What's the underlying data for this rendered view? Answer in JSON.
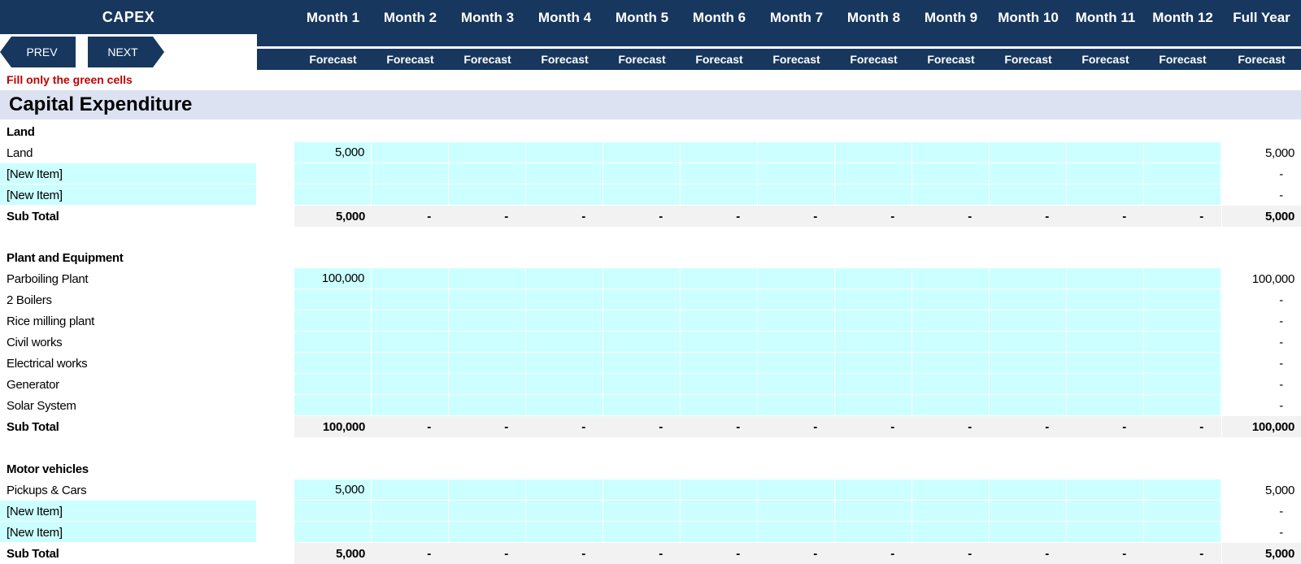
{
  "sheet": {
    "title": "CAPEX",
    "prev_label": "PREV",
    "next_label": "NEXT",
    "note": "Fill only the green cells",
    "section_title": "Capital Expenditure"
  },
  "columns": [
    "Month 1",
    "Month 2",
    "Month 3",
    "Month 4",
    "Month 5",
    "Month 6",
    "Month 7",
    "Month 8",
    "Month 9",
    "Month 10",
    "Month 11",
    "Month 12",
    "Full Year"
  ],
  "subheader": "Forecast",
  "colors": {
    "header_bg": "#17375e",
    "input_cell": "#ccffff",
    "section_bg": "#dce2f1",
    "subtotal_bg": "#f2f2f2",
    "note": "#c00000"
  },
  "groups": [
    {
      "title": "Land",
      "items": [
        {
          "label": "Land",
          "month1": "5,000",
          "full_year": "5,000",
          "editable_label": false
        },
        {
          "label": "[New Item]",
          "month1": "",
          "full_year": "-",
          "editable_label": true
        },
        {
          "label": "[New Item]",
          "month1": "",
          "full_year": "-",
          "editable_label": true
        }
      ],
      "subtotal": {
        "label": "Sub Total",
        "month1": "5,000",
        "other": "-",
        "full_year": "5,000"
      }
    },
    {
      "title": "Plant and Equipment",
      "items": [
        {
          "label": "Parboiling Plant",
          "month1": "100,000",
          "full_year": "100,000",
          "editable_label": false
        },
        {
          "label": "2 Boilers",
          "month1": "",
          "full_year": "-",
          "editable_label": false
        },
        {
          "label": "Rice milling plant",
          "month1": "",
          "full_year": "-",
          "editable_label": false
        },
        {
          "label": "Civil works",
          "month1": "",
          "full_year": "-",
          "editable_label": false
        },
        {
          "label": "Electrical works",
          "month1": "",
          "full_year": "-",
          "editable_label": false
        },
        {
          "label": "Generator",
          "month1": "",
          "full_year": "-",
          "editable_label": false
        },
        {
          "label": "Solar System",
          "month1": "",
          "full_year": "-",
          "editable_label": false
        }
      ],
      "subtotal": {
        "label": "Sub Total",
        "month1": "100,000",
        "other": "-",
        "full_year": "100,000"
      }
    },
    {
      "title": "Motor vehicles",
      "items": [
        {
          "label": "Pickups & Cars",
          "month1": "5,000",
          "full_year": "5,000",
          "editable_label": false
        },
        {
          "label": "[New Item]",
          "month1": "",
          "full_year": "-",
          "editable_label": true
        },
        {
          "label": "[New Item]",
          "month1": "",
          "full_year": "-",
          "editable_label": true
        }
      ],
      "subtotal": {
        "label": "Sub Total",
        "month1": "5,000",
        "other": "-",
        "full_year": "5,000"
      }
    }
  ]
}
